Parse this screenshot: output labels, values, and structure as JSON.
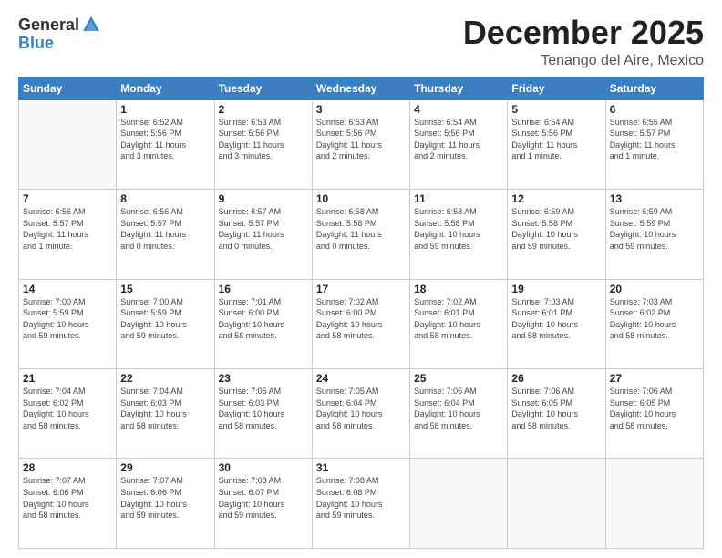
{
  "logo": {
    "general": "General",
    "blue": "Blue"
  },
  "title": {
    "month_year": "December 2025",
    "location": "Tenango del Aire, Mexico"
  },
  "headers": [
    "Sunday",
    "Monday",
    "Tuesday",
    "Wednesday",
    "Thursday",
    "Friday",
    "Saturday"
  ],
  "weeks": [
    [
      {
        "day": "",
        "info": ""
      },
      {
        "day": "1",
        "info": "Sunrise: 6:52 AM\nSunset: 5:56 PM\nDaylight: 11 hours\nand 3 minutes."
      },
      {
        "day": "2",
        "info": "Sunrise: 6:53 AM\nSunset: 5:56 PM\nDaylight: 11 hours\nand 3 minutes."
      },
      {
        "day": "3",
        "info": "Sunrise: 6:53 AM\nSunset: 5:56 PM\nDaylight: 11 hours\nand 2 minutes."
      },
      {
        "day": "4",
        "info": "Sunrise: 6:54 AM\nSunset: 5:56 PM\nDaylight: 11 hours\nand 2 minutes."
      },
      {
        "day": "5",
        "info": "Sunrise: 6:54 AM\nSunset: 5:56 PM\nDaylight: 11 hours\nand 1 minute."
      },
      {
        "day": "6",
        "info": "Sunrise: 6:55 AM\nSunset: 5:57 PM\nDaylight: 11 hours\nand 1 minute."
      }
    ],
    [
      {
        "day": "7",
        "info": "Sunrise: 6:56 AM\nSunset: 5:57 PM\nDaylight: 11 hours\nand 1 minute."
      },
      {
        "day": "8",
        "info": "Sunrise: 6:56 AM\nSunset: 5:57 PM\nDaylight: 11 hours\nand 0 minutes."
      },
      {
        "day": "9",
        "info": "Sunrise: 6:57 AM\nSunset: 5:57 PM\nDaylight: 11 hours\nand 0 minutes."
      },
      {
        "day": "10",
        "info": "Sunrise: 6:58 AM\nSunset: 5:58 PM\nDaylight: 11 hours\nand 0 minutes."
      },
      {
        "day": "11",
        "info": "Sunrise: 6:58 AM\nSunset: 5:58 PM\nDaylight: 10 hours\nand 59 minutes."
      },
      {
        "day": "12",
        "info": "Sunrise: 6:59 AM\nSunset: 5:58 PM\nDaylight: 10 hours\nand 59 minutes."
      },
      {
        "day": "13",
        "info": "Sunrise: 6:59 AM\nSunset: 5:59 PM\nDaylight: 10 hours\nand 59 minutes."
      }
    ],
    [
      {
        "day": "14",
        "info": "Sunrise: 7:00 AM\nSunset: 5:59 PM\nDaylight: 10 hours\nand 59 minutes."
      },
      {
        "day": "15",
        "info": "Sunrise: 7:00 AM\nSunset: 5:59 PM\nDaylight: 10 hours\nand 59 minutes."
      },
      {
        "day": "16",
        "info": "Sunrise: 7:01 AM\nSunset: 6:00 PM\nDaylight: 10 hours\nand 58 minutes."
      },
      {
        "day": "17",
        "info": "Sunrise: 7:02 AM\nSunset: 6:00 PM\nDaylight: 10 hours\nand 58 minutes."
      },
      {
        "day": "18",
        "info": "Sunrise: 7:02 AM\nSunset: 6:01 PM\nDaylight: 10 hours\nand 58 minutes."
      },
      {
        "day": "19",
        "info": "Sunrise: 7:03 AM\nSunset: 6:01 PM\nDaylight: 10 hours\nand 58 minutes."
      },
      {
        "day": "20",
        "info": "Sunrise: 7:03 AM\nSunset: 6:02 PM\nDaylight: 10 hours\nand 58 minutes."
      }
    ],
    [
      {
        "day": "21",
        "info": "Sunrise: 7:04 AM\nSunset: 6:02 PM\nDaylight: 10 hours\nand 58 minutes."
      },
      {
        "day": "22",
        "info": "Sunrise: 7:04 AM\nSunset: 6:03 PM\nDaylight: 10 hours\nand 58 minutes."
      },
      {
        "day": "23",
        "info": "Sunrise: 7:05 AM\nSunset: 6:03 PM\nDaylight: 10 hours\nand 58 minutes."
      },
      {
        "day": "24",
        "info": "Sunrise: 7:05 AM\nSunset: 6:04 PM\nDaylight: 10 hours\nand 58 minutes."
      },
      {
        "day": "25",
        "info": "Sunrise: 7:06 AM\nSunset: 6:04 PM\nDaylight: 10 hours\nand 58 minutes."
      },
      {
        "day": "26",
        "info": "Sunrise: 7:06 AM\nSunset: 6:05 PM\nDaylight: 10 hours\nand 58 minutes."
      },
      {
        "day": "27",
        "info": "Sunrise: 7:06 AM\nSunset: 6:05 PM\nDaylight: 10 hours\nand 58 minutes."
      }
    ],
    [
      {
        "day": "28",
        "info": "Sunrise: 7:07 AM\nSunset: 6:06 PM\nDaylight: 10 hours\nand 58 minutes."
      },
      {
        "day": "29",
        "info": "Sunrise: 7:07 AM\nSunset: 6:06 PM\nDaylight: 10 hours\nand 59 minutes."
      },
      {
        "day": "30",
        "info": "Sunrise: 7:08 AM\nSunset: 6:07 PM\nDaylight: 10 hours\nand 59 minutes."
      },
      {
        "day": "31",
        "info": "Sunrise: 7:08 AM\nSunset: 6:08 PM\nDaylight: 10 hours\nand 59 minutes."
      },
      {
        "day": "",
        "info": ""
      },
      {
        "day": "",
        "info": ""
      },
      {
        "day": "",
        "info": ""
      }
    ]
  ]
}
